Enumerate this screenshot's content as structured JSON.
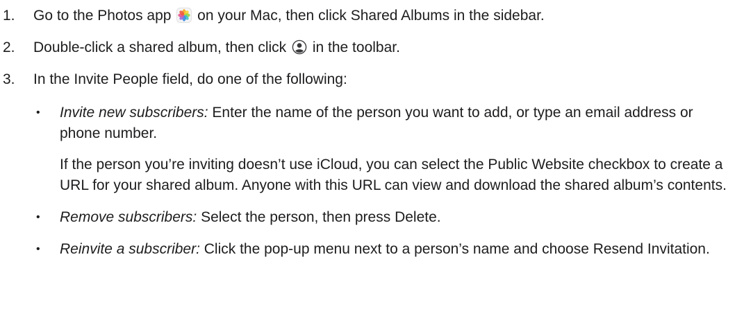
{
  "steps": [
    {
      "number": "1.",
      "text_before_icon": "Go to the Photos app ",
      "icon": "photos-app-icon",
      "text_after_icon": " on your Mac, then click Shared Albums in the sidebar."
    },
    {
      "number": "2.",
      "text_before_icon": "Double-click a shared album, then click ",
      "icon": "people-button-icon",
      "text_after_icon": " in the toolbar."
    },
    {
      "number": "3.",
      "text": "In the Invite People field, do one of the following:",
      "bullets": [
        {
          "bullet": "•",
          "italic": "Invite new subscribers:",
          "text": " Enter the name of the person you want to add, or type an email address or phone number.",
          "note": "If the person you’re inviting doesn’t use iCloud, you can select the Public Website checkbox to create a URL for your shared album. Anyone with this URL can view and download the shared album’s contents."
        },
        {
          "bullet": "•",
          "italic": "Remove subscribers:",
          "text": " Select the person, then press Delete."
        },
        {
          "bullet": "•",
          "italic": "Reinvite a subscriber:",
          "text": " Click the pop-up menu next to a person’s name and choose Resend Invitation."
        }
      ]
    }
  ]
}
